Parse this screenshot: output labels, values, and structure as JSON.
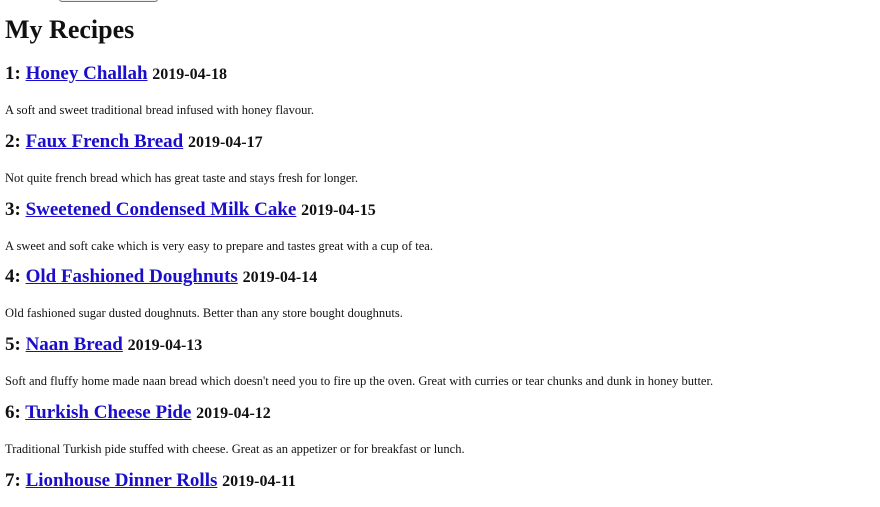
{
  "page": {
    "title": "My Recipes"
  },
  "recipes": [
    {
      "index": "1:",
      "title": "Honey Challah",
      "date": "2019-04-18",
      "description": "A soft and sweet traditional bread infused with honey flavour."
    },
    {
      "index": "2:",
      "title": "Faux French Bread",
      "date": "2019-04-17",
      "description": "Not quite french bread which has great taste and stays fresh for longer."
    },
    {
      "index": "3:",
      "title": "Sweetened Condensed Milk Cake",
      "date": "2019-04-15",
      "description": "A sweet and soft cake which is very easy to prepare and tastes great with a cup of tea."
    },
    {
      "index": "4:",
      "title": "Old Fashioned Doughnuts",
      "date": "2019-04-14",
      "description": "Old fashioned sugar dusted doughnuts. Better than any store bought doughnuts."
    },
    {
      "index": "5:",
      "title": "Naan Bread",
      "date": "2019-04-13",
      "description": "Soft and fluffy home made naan bread which doesn't need you to fire up the oven. Great with curries or tear chunks and dunk in honey butter."
    },
    {
      "index": "6:",
      "title": "Turkish Cheese Pide",
      "date": "2019-04-12",
      "description": "Traditional Turkish pide stuffed with cheese. Great as an appetizer or for breakfast or lunch."
    },
    {
      "index": "7:",
      "title": "Lionhouse Dinner Rolls",
      "date": "2019-04-11",
      "description": ""
    }
  ]
}
